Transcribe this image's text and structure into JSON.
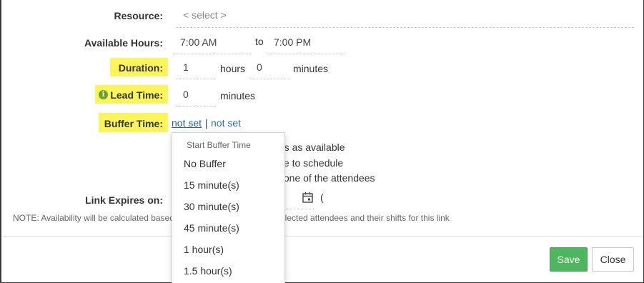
{
  "form": {
    "resource": {
      "label": "Resource:",
      "value": "< select >"
    },
    "available_hours": {
      "label": "Available Hours:",
      "from": "7:00 AM",
      "to_word": "to",
      "to": "7:00 PM"
    },
    "duration": {
      "label": "Duration:",
      "hours_value": "1",
      "hours_unit": "hours",
      "minutes_value": "0",
      "minutes_unit": "minutes"
    },
    "lead_time": {
      "label": "Lead Time:",
      "value": "0",
      "unit": "minutes"
    },
    "buffer_time": {
      "label": "Buffer Time:",
      "start_link": "not set",
      "separator": "|",
      "end_link": "not set"
    },
    "partial_options": {
      "line1": "ots as available",
      "line2": "ple to schedule",
      "line3": "y one of the attendees"
    },
    "link_expires": {
      "label": "Link Expires on:",
      "extra": "("
    },
    "note": "NOTE: Availability will be calculated based",
    "note_tail": "elected attendees and their shifts for this link"
  },
  "dropdown": {
    "header": "Start Buffer Time",
    "items": [
      "No Buffer",
      "15 minute(s)",
      "30 minute(s)",
      "45 minute(s)",
      "1 hour(s)",
      "1.5 hour(s)"
    ]
  },
  "footer": {
    "save_label": "Save",
    "close_label": "Close"
  },
  "colors": {
    "highlight": "#fbf55a",
    "save": "#4fb55e",
    "link": "#2a6fb5",
    "info_icon": "#6aa329"
  },
  "icons": {
    "info": "info-icon",
    "calendar": "calendar-icon"
  }
}
